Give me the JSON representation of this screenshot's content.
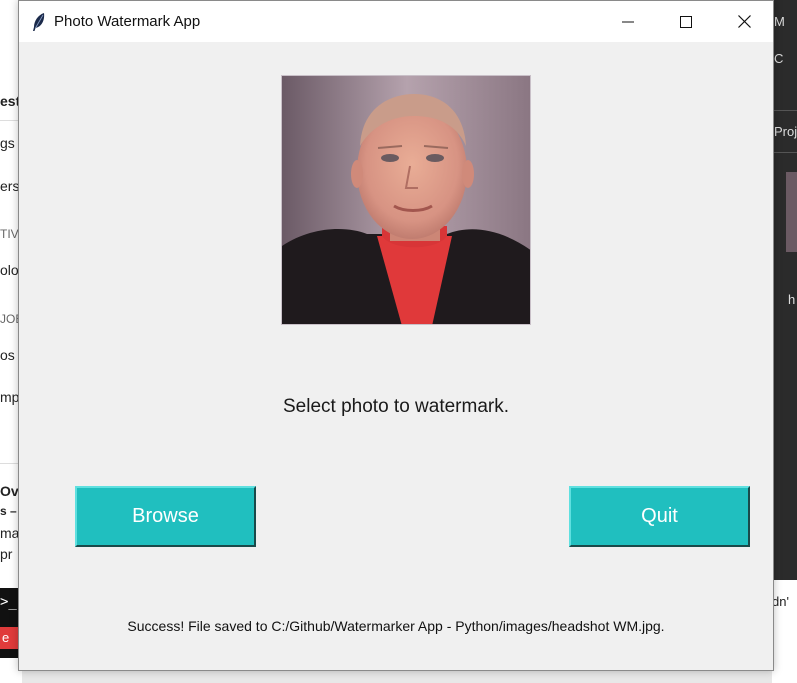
{
  "window": {
    "title": "Photo Watermark App",
    "controls": {
      "minimize_icon": "minimize-icon",
      "maximize_icon": "maximize-icon",
      "close_icon": "close-icon"
    }
  },
  "main": {
    "photo_alt": "headshot photo",
    "prompt": "Select photo to watermark.",
    "browse_label": "Browse",
    "quit_label": "Quit",
    "status": "Success!  File saved to C:/Github/Watermarker App - Python/images/headshot WM.jpg."
  },
  "background": {
    "left_texts": [
      "est",
      "gs",
      "ers",
      "TIV",
      "olo",
      "JOB",
      "os",
      "mp",
      "Ov",
      "s –",
      "mar",
      "pr"
    ],
    "left_prompt": ">_",
    "left_button": "e",
    "right_texts": [
      "M",
      "C",
      "Proj",
      "h",
      "dn'"
    ]
  },
  "colors": {
    "button_bg": "#20bfbf",
    "button_text": "#ffffff",
    "window_bg": "#f0f0f0",
    "titlebar_bg": "#ffffff"
  }
}
